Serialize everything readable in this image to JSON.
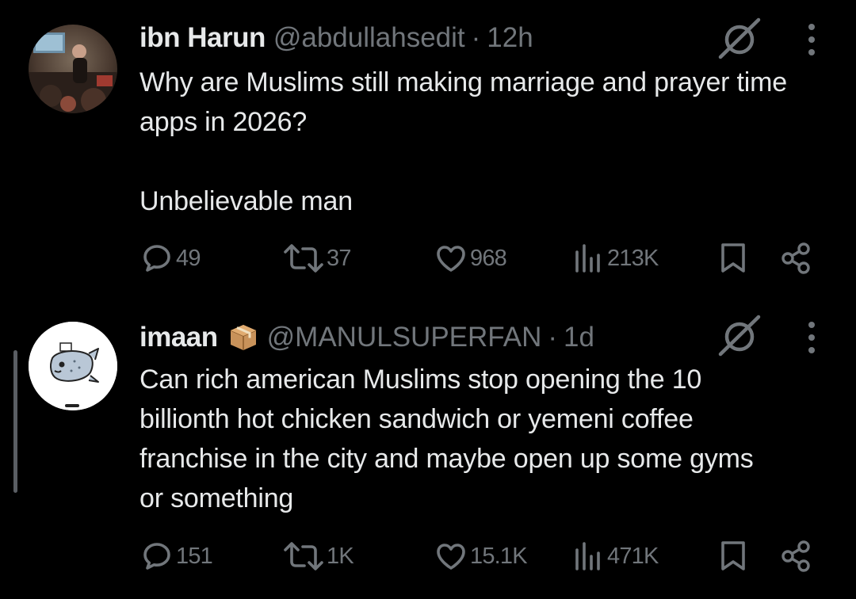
{
  "tweets": [
    {
      "name": "ibn Harun",
      "handle": "@abdullahsedit",
      "separator": "·",
      "time": "12h",
      "avatar_icon": "photo-avatar",
      "text_paragraphs": [
        "Why are Muslims still making marriage and prayer time apps in 2026?",
        "Unbelievable man"
      ],
      "replies": "49",
      "reposts": "37",
      "likes": "968",
      "views": "213K"
    },
    {
      "name": "imaan",
      "name_emoji": "package-emoji",
      "handle": "@MANULSUPERFAN",
      "separator": "·",
      "time": "1d",
      "avatar_icon": "sunfish-cartoon-avatar",
      "text_paragraphs": [
        "Can rich american Muslims stop opening the 10 billionth hot chicken sandwich or yemeni coffee franchise in the city and maybe open up some gyms or something"
      ],
      "replies": "151",
      "reposts": "1K",
      "likes": "15.1K",
      "views": "471K"
    }
  ],
  "colors": {
    "background": "#000000",
    "text": "#e7e9ea",
    "muted": "#71767b"
  }
}
